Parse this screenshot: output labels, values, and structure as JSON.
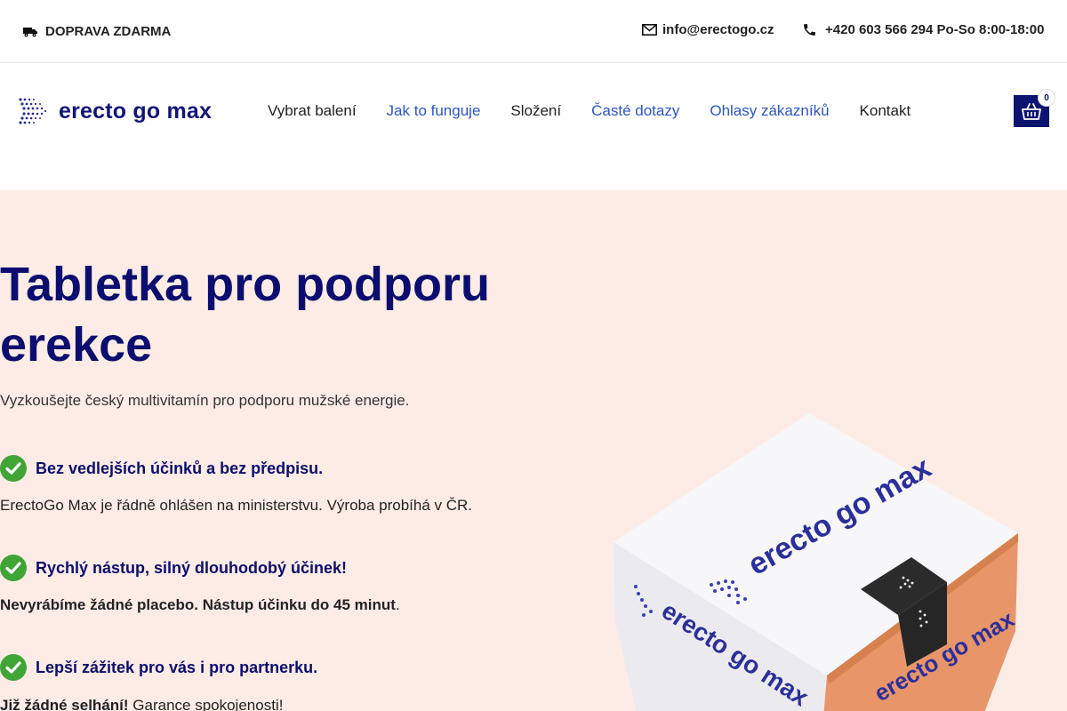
{
  "topbar": {
    "shipping": "DOPRAVA ZDARMA",
    "email": "info@erectogo.cz",
    "phone": "+420 603 566 294 Po-So 8:00-18:00"
  },
  "header": {
    "logo_text": "erecto go max",
    "nav": [
      "Vybrat balení",
      "Jak to funguje",
      "Složení",
      "Časté dotazy",
      "Ohlasy zákazníků",
      "Kontakt"
    ],
    "cart_count": "0"
  },
  "hero": {
    "title": "Tabletka pro podporu erekce",
    "subtitle": "Vyzkoušejte český multivitamín pro podporu mužské energie.",
    "features": [
      {
        "title": "Bez vedlejších účinků a bez předpisu.",
        "text": "ErectoGo Max je řádně ohlášen na ministerstvu. Výroba probíhá v ČR."
      },
      {
        "title": "Rychlý nástup, silný dlouhodobý účinek!",
        "text_bold": "Nevyrábíme žádné placebo. Nástup účinku do 45 minut",
        "text_tail": "."
      },
      {
        "title": "Lepší zážitek pro vás i pro partnerku.",
        "text_bold": "Již žádné selhání!",
        "text_tail": " Garance spokojenosti!"
      }
    ],
    "box_label": "erecto go max"
  },
  "colors": {
    "brand_navy": "#0b0e6e",
    "link_blue": "#2a56c6",
    "hero_bg": "#fdece6",
    "check_green": "#3fa535",
    "box_orange": "#e8956a"
  }
}
